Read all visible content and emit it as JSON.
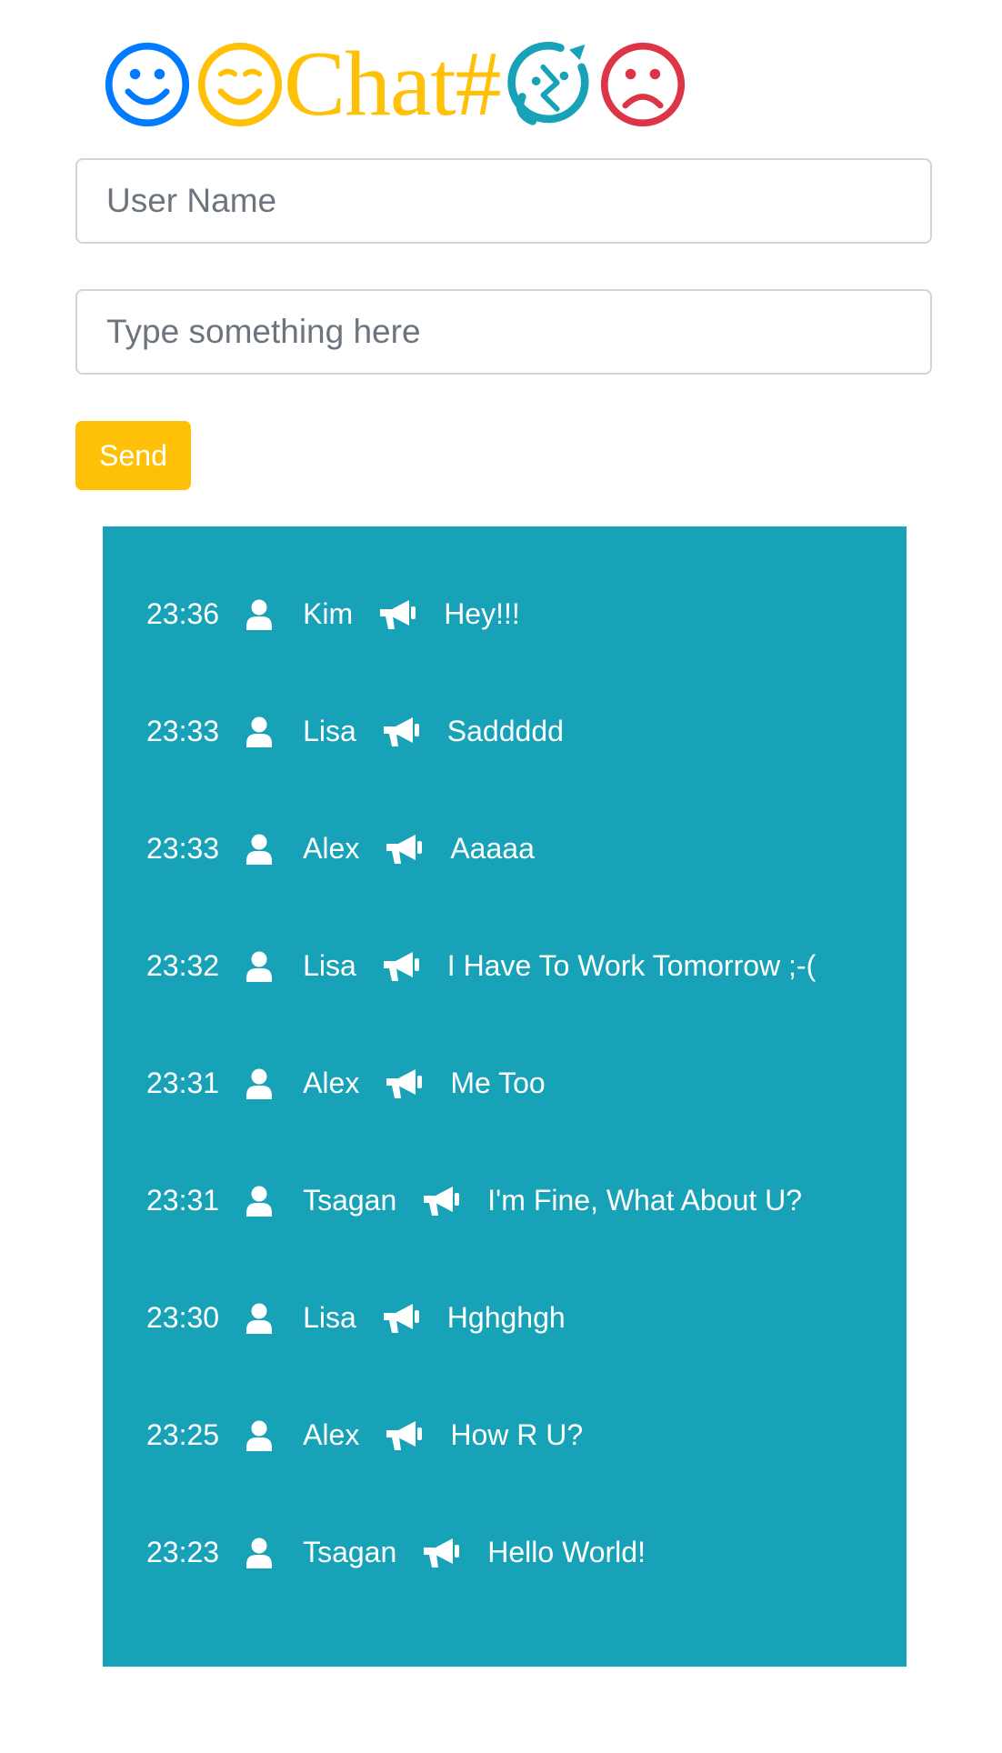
{
  "logo": {
    "text": "Chat#",
    "faces": [
      {
        "icon": "smile-face-icon",
        "color": "#007bff"
      },
      {
        "icon": "wink-face-icon",
        "color": "#ffc107"
      },
      {
        "icon": "dizzy-face-icon",
        "color": "#17a2b8"
      },
      {
        "icon": "sad-face-icon",
        "color": "#dc3545"
      }
    ]
  },
  "form": {
    "name_placeholder": "User Name",
    "message_placeholder": "Type something here",
    "send_label": "Send"
  },
  "colors": {
    "accent": "#ffc107",
    "panel": "#17a2b8"
  },
  "messages": [
    {
      "time": "23:36",
      "user": "Kim",
      "text": "Hey!!!"
    },
    {
      "time": "23:33",
      "user": "Lisa",
      "text": "Saddddd"
    },
    {
      "time": "23:33",
      "user": "Alex",
      "text": "Aaaaa"
    },
    {
      "time": "23:32",
      "user": "Lisa",
      "text": "I Have To Work Tomorrow ;-("
    },
    {
      "time": "23:31",
      "user": "Alex",
      "text": "Me Too"
    },
    {
      "time": "23:31",
      "user": "Tsagan",
      "text": "I'm Fine, What About U?"
    },
    {
      "time": "23:30",
      "user": "Lisa",
      "text": "Hghghgh"
    },
    {
      "time": "23:25",
      "user": "Alex",
      "text": "How R U?"
    },
    {
      "time": "23:23",
      "user": "Tsagan",
      "text": "Hello World!"
    }
  ]
}
